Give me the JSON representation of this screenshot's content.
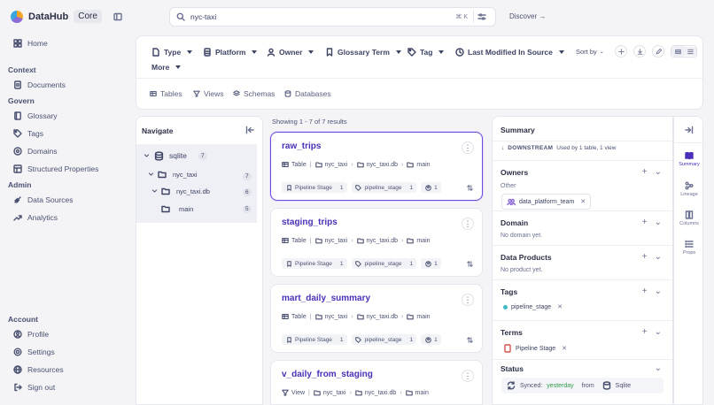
{
  "app": {
    "brand": "DataHub",
    "edition": "Core"
  },
  "sidebar": {
    "home": "Home",
    "context_label": "Context",
    "documents": "Documents",
    "govern_label": "Govern",
    "glossary": "Glossary",
    "tags": "Tags",
    "domains": "Domains",
    "structured_properties": "Structured Properties",
    "admin_label": "Admin",
    "data_sources": "Data Sources",
    "analytics": "Analytics",
    "account_label": "Account",
    "profile": "Profile",
    "settings": "Settings",
    "resources": "Resources",
    "sign_out": "Sign out"
  },
  "search": {
    "value": "nyc-taxi",
    "shortcut": "⌘ K"
  },
  "discover": "Discover →",
  "filters": {
    "type": "Type",
    "platform": "Platform",
    "owner": "Owner",
    "glossary_term": "Glossary Term",
    "tag": "Tag",
    "last_modified": "Last Modified In Source",
    "more": "More",
    "sort_by": "Sort by"
  },
  "quick_tabs": [
    "Tables",
    "Views",
    "Schemas",
    "Databases"
  ],
  "navigate": {
    "title": "Navigate",
    "tree": [
      {
        "label": "sqlite",
        "count": "7"
      },
      {
        "label": "nyc_taxi",
        "count": "7"
      },
      {
        "label": "nyc_taxi.db",
        "count": "6"
      },
      {
        "label": "main",
        "count": "5"
      }
    ]
  },
  "results": {
    "showing": "Showing 1 - 7 of 7 results",
    "cards": [
      {
        "title": "raw_trips",
        "type": "Table",
        "path": [
          "nyc_taxi",
          "nyc_taxi.db",
          "main"
        ],
        "term": "Pipeline Stage",
        "term_count": "1",
        "tag": "pipeline_stage",
        "tag_count": "1",
        "owners": "1"
      },
      {
        "title": "staging_trips",
        "type": "Table",
        "path": [
          "nyc_taxi",
          "nyc_taxi.db",
          "main"
        ],
        "term": "Pipeline Stage",
        "term_count": "1",
        "tag": "pipeline_stage",
        "tag_count": "1",
        "owners": "1"
      },
      {
        "title": "mart_daily_summary",
        "type": "Table",
        "path": [
          "nyc_taxi",
          "nyc_taxi.db",
          "main"
        ],
        "term": "Pipeline Stage",
        "term_count": "1",
        "tag": "pipeline_stage",
        "tag_count": "1",
        "owners": "1"
      },
      {
        "title": "v_daily_from_staging",
        "type": "View",
        "path": [
          "nyc_taxi",
          "nyc_taxi.db",
          "main"
        ]
      }
    ]
  },
  "summary": {
    "title": "Summary",
    "downstream_label": "DOWNSTREAM",
    "downstream_text": "Used by 1 table, 1 view",
    "owners_h": "Owners",
    "owners_group": "Other",
    "owner": "data_platform_team",
    "domain_h": "Domain",
    "domain_empty": "No domain yet.",
    "products_h": "Data Products",
    "products_empty": "No product yet.",
    "tags_h": "Tags",
    "tag": "pipeline_stage",
    "terms_h": "Terms",
    "term": "Pipeline Stage",
    "status_h": "Status",
    "synced": "Synced:",
    "synced_when": "yesterday",
    "from": "from",
    "platform": "Sqlite"
  },
  "rail": [
    "Summary",
    "Lineage",
    "Columns",
    "Props"
  ],
  "colors": {
    "accent": "#4c2fb8",
    "tag_dot": "#3fb8c6",
    "synced_green": "#2f9a4e"
  }
}
